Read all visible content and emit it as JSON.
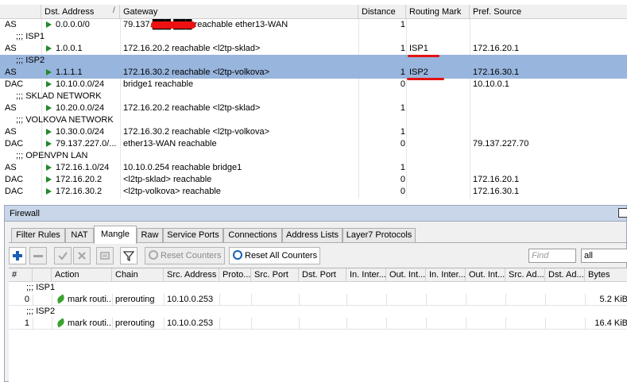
{
  "routes": {
    "columns": {
      "flags": "",
      "dst": "Dst. Address",
      "gateway": "Gateway",
      "distance": "Distance",
      "routing_mark": "Routing Mark",
      "pref_source": "Pref. Source"
    },
    "rows": [
      {
        "kind": "route",
        "flags": "AS",
        "dst": "0.0.0.0/0",
        "gateway": "79.137.███.███ reachable ether13-WAN",
        "distance": "1",
        "routing_mark": "",
        "pref_source": ""
      },
      {
        "kind": "comment",
        "text": ";;; ISP1"
      },
      {
        "kind": "route",
        "flags": "AS",
        "dst": "1.0.0.1",
        "gateway": "172.16.20.2 reachable <l2tp-sklad>",
        "distance": "1",
        "routing_mark": "ISP1",
        "pref_source": "172.16.20.1"
      },
      {
        "kind": "comment",
        "text": ";;; ISP2",
        "selected": true
      },
      {
        "kind": "route",
        "flags": "AS",
        "dst": "1.1.1.1",
        "gateway": "172.16.30.2 reachable <l2tp-volkova>",
        "distance": "1",
        "routing_mark": "ISP2",
        "pref_source": "172.16.30.1",
        "selected": true
      },
      {
        "kind": "route",
        "flags": "DAC",
        "dst": "10.10.0.0/24",
        "gateway": "bridge1 reachable",
        "distance": "0",
        "routing_mark": "",
        "pref_source": "10.10.0.1"
      },
      {
        "kind": "comment",
        "text": ";;; SKLAD NETWORK"
      },
      {
        "kind": "route",
        "flags": "AS",
        "dst": "10.20.0.0/24",
        "gateway": "172.16.20.2 reachable <l2tp-sklad>",
        "distance": "1",
        "routing_mark": "",
        "pref_source": ""
      },
      {
        "kind": "comment",
        "text": ";;; VOLKOVA NETWORK"
      },
      {
        "kind": "route",
        "flags": "AS",
        "dst": "10.30.0.0/24",
        "gateway": "172.16.30.2 reachable <l2tp-volkova>",
        "distance": "1",
        "routing_mark": "",
        "pref_source": ""
      },
      {
        "kind": "route",
        "flags": "DAC",
        "dst": "79.137.227.0/...",
        "gateway": "ether13-WAN reachable",
        "distance": "0",
        "routing_mark": "",
        "pref_source": "79.137.227.70"
      },
      {
        "kind": "comment",
        "text": ";;; OPENVPN LAN"
      },
      {
        "kind": "route",
        "flags": "AS",
        "dst": "172.16.1.0/24",
        "gateway": "10.10.0.254 reachable bridge1",
        "distance": "1",
        "routing_mark": "",
        "pref_source": ""
      },
      {
        "kind": "route",
        "flags": "DAC",
        "dst": "172.16.20.2",
        "gateway": "<l2tp-sklad> reachable",
        "distance": "0",
        "routing_mark": "",
        "pref_source": "172.16.20.1"
      },
      {
        "kind": "route",
        "flags": "DAC",
        "dst": "172.16.30.2",
        "gateway": "<l2tp-volkova> reachable",
        "distance": "0",
        "routing_mark": "",
        "pref_source": "172.16.30.1"
      }
    ]
  },
  "firewall": {
    "title": "Firewall",
    "tabs": [
      "Filter Rules",
      "NAT",
      "Mangle",
      "Raw",
      "Service Ports",
      "Connections",
      "Address Lists",
      "Layer7 Protocols"
    ],
    "active_tab": "Mangle",
    "toolbar": {
      "add_icon": "plus-icon",
      "remove_icon": "minus-icon",
      "enable_icon": "check-icon",
      "disable_icon": "x-icon",
      "comment_icon": "note-icon",
      "filter_icon": "funnel-icon",
      "reset_counters": "Reset Counters",
      "reset_all_counters": "Reset All Counters",
      "find_placeholder": "Find",
      "filter_value": "all"
    },
    "columns": [
      "#",
      "Action",
      "Chain",
      "Src. Address",
      "Proto...",
      "Src. Port",
      "Dst. Port",
      "In. Inter...",
      "Out. Int...",
      "In. Inter...",
      "Out. Int...",
      "Src. Ad...",
      "Dst. Ad...",
      "Bytes"
    ],
    "rows": [
      {
        "kind": "comment",
        "text": ";;; ISP1"
      },
      {
        "kind": "rule",
        "num": "0",
        "action": "mark routi...",
        "chain": "prerouting",
        "src_address": "10.10.0.253",
        "bytes": "5.2 KiB"
      },
      {
        "kind": "comment",
        "text": ";;; ISP2"
      },
      {
        "kind": "rule",
        "num": "1",
        "action": "mark routi...",
        "chain": "prerouting",
        "src_address": "10.10.0.253",
        "bytes": "16.4 KiB"
      }
    ]
  },
  "colors": {
    "selection": "#98b5dd",
    "annotation_red": "#e31313",
    "play_green": "#1f8a28",
    "action_green": "#3aa22f"
  }
}
